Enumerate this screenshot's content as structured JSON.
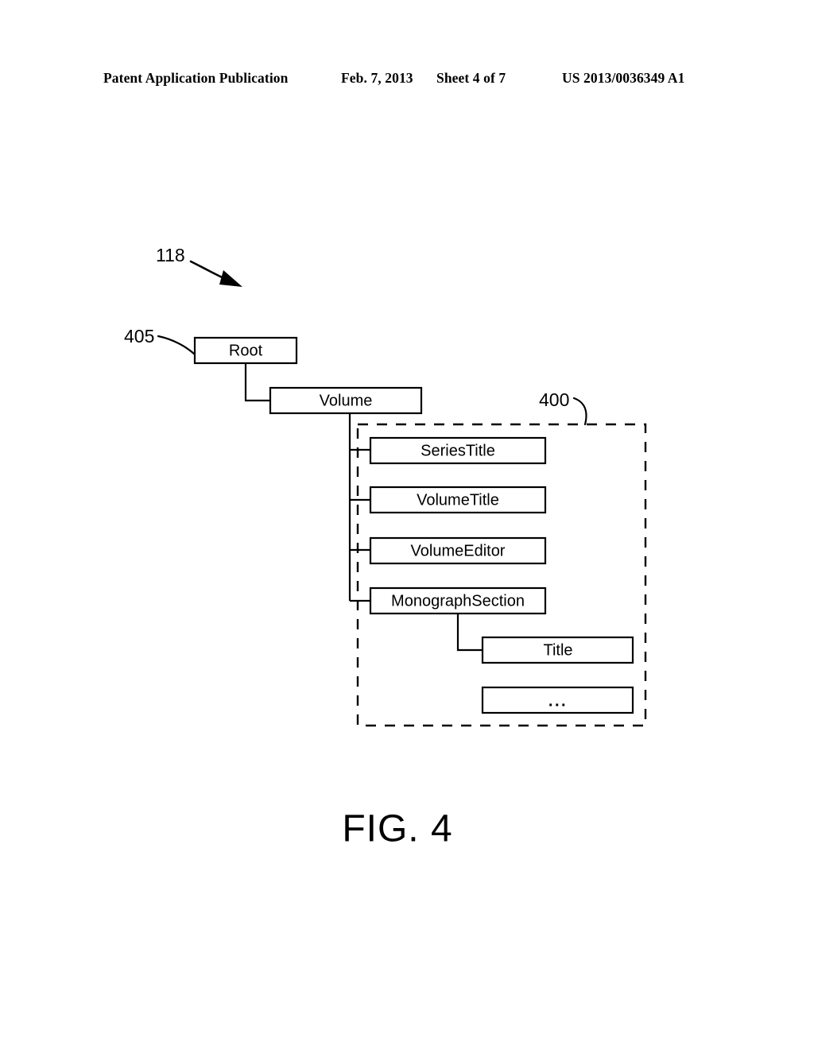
{
  "header": {
    "publication": "Patent Application Publication",
    "date": "Feb. 7, 2013",
    "sheet": "Sheet 4 of 7",
    "number": "US 2013/0036349 A1"
  },
  "figure": {
    "caption": "FIG. 4",
    "diagram_ref": "118",
    "root_ref": "405",
    "group_ref": "400",
    "nodes": {
      "root": "Root",
      "volume": "Volume",
      "series_title": "SeriesTitle",
      "volume_title": "VolumeTitle",
      "volume_editor": "VolumeEditor",
      "monograph_section": "MonographSection",
      "title": "Title",
      "ellipsis": "..."
    }
  },
  "colors": {
    "ink": "#000000",
    "paper": "#ffffff"
  }
}
